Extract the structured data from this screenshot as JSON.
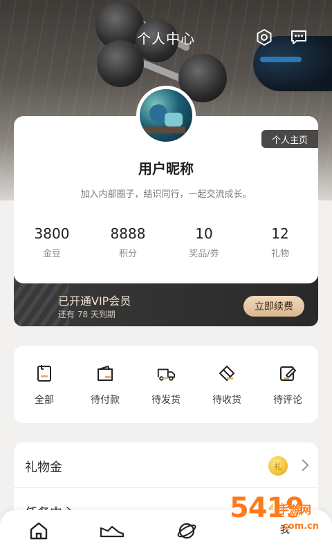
{
  "header": {
    "title": "个人中心"
  },
  "profile": {
    "homepage_label": "个人主页",
    "nickname": "用户昵称",
    "bio": "加入内部圈子，结识同行，一起交流成长。",
    "stats": [
      {
        "value": "3800",
        "label": "金豆"
      },
      {
        "value": "8888",
        "label": "积分"
      },
      {
        "value": "10",
        "label": "奖品/券"
      },
      {
        "value": "12",
        "label": "礼物"
      }
    ]
  },
  "vip": {
    "title": "已开通VIP会员",
    "subtitle": "还有 78 天到期",
    "renew_label": "立即续费"
  },
  "orders": [
    {
      "label": "全部",
      "icon": "clipboard-icon"
    },
    {
      "label": "待付款",
      "icon": "wallet-icon"
    },
    {
      "label": "待发货",
      "icon": "truck-icon"
    },
    {
      "label": "待收货",
      "icon": "package-icon"
    },
    {
      "label": "待评论",
      "icon": "edit-note-icon"
    }
  ],
  "list": [
    {
      "label": "礼物金",
      "badge": "礼"
    },
    {
      "label": "任务中心",
      "badge": ""
    }
  ],
  "bottom_nav": {
    "items": [
      {
        "icon": "home-icon"
      },
      {
        "icon": "shoe-icon"
      },
      {
        "icon": "planet-icon"
      }
    ],
    "me_label": "我"
  },
  "watermark": {
    "number": "5419",
    "text": "手游网",
    "site": ".com.cn"
  },
  "colors": {
    "accent": "#d8b78f",
    "dark": "#2a2929",
    "watermark": "#ff7a1a"
  }
}
